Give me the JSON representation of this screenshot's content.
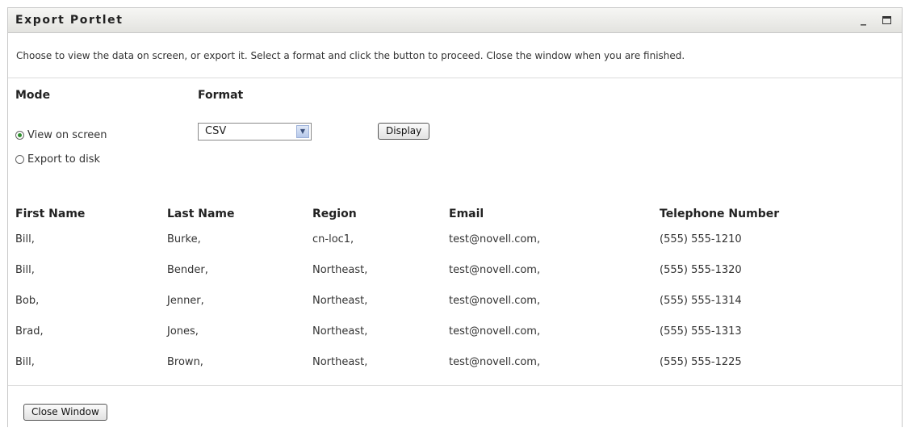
{
  "window": {
    "title": "Export Portlet",
    "minimize_glyph": "_"
  },
  "description": "Choose to view the data on screen, or export it. Select a format and click the button to proceed. Close the window when you are finished.",
  "mode": {
    "label": "Mode",
    "options": [
      {
        "label": "View on screen",
        "checked": true
      },
      {
        "label": "Export to disk",
        "checked": false
      }
    ]
  },
  "format": {
    "label": "Format",
    "selected": "CSV"
  },
  "display_button": "Display",
  "table": {
    "headers": [
      "First Name",
      "Last Name",
      "Region",
      "Email",
      "Telephone Number"
    ],
    "rows": [
      [
        "Bill,",
        "Burke,",
        "cn-loc1,",
        "test@novell.com,",
        "(555) 555-1210"
      ],
      [
        "Bill,",
        "Bender,",
        "Northeast,",
        "test@novell.com,",
        "(555) 555-1320"
      ],
      [
        "Bob,",
        "Jenner,",
        "Northeast,",
        "test@novell.com,",
        "(555) 555-1314"
      ],
      [
        "Brad,",
        "Jones,",
        "Northeast,",
        "test@novell.com,",
        "(555) 555-1313"
      ],
      [
        "Bill,",
        "Brown,",
        "Northeast,",
        "test@novell.com,",
        "(555) 555-1225"
      ]
    ]
  },
  "close_button": "Close Window"
}
